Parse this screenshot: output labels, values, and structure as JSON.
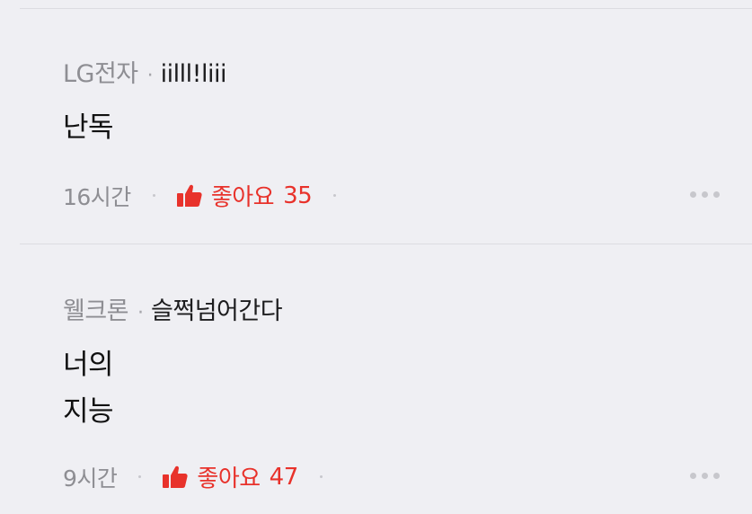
{
  "comments": [
    {
      "author": "LG전자",
      "separator": "·",
      "community": "iilll!liii",
      "body": "난독",
      "time": "16시간",
      "like_label": "좋아요",
      "like_count": "35"
    },
    {
      "author": "웰크론",
      "separator": "·",
      "community": "슬쩍넘어간다",
      "body": "너의\n지능",
      "time": "9시간",
      "like_label": "좋아요",
      "like_count": "47"
    }
  ],
  "colors": {
    "background": "#efeff3",
    "like_accent": "#e8322b",
    "muted_text": "#8e8e93"
  },
  "icons": {
    "like": "thumbs-up-icon",
    "more": "more-horizontal-icon"
  }
}
